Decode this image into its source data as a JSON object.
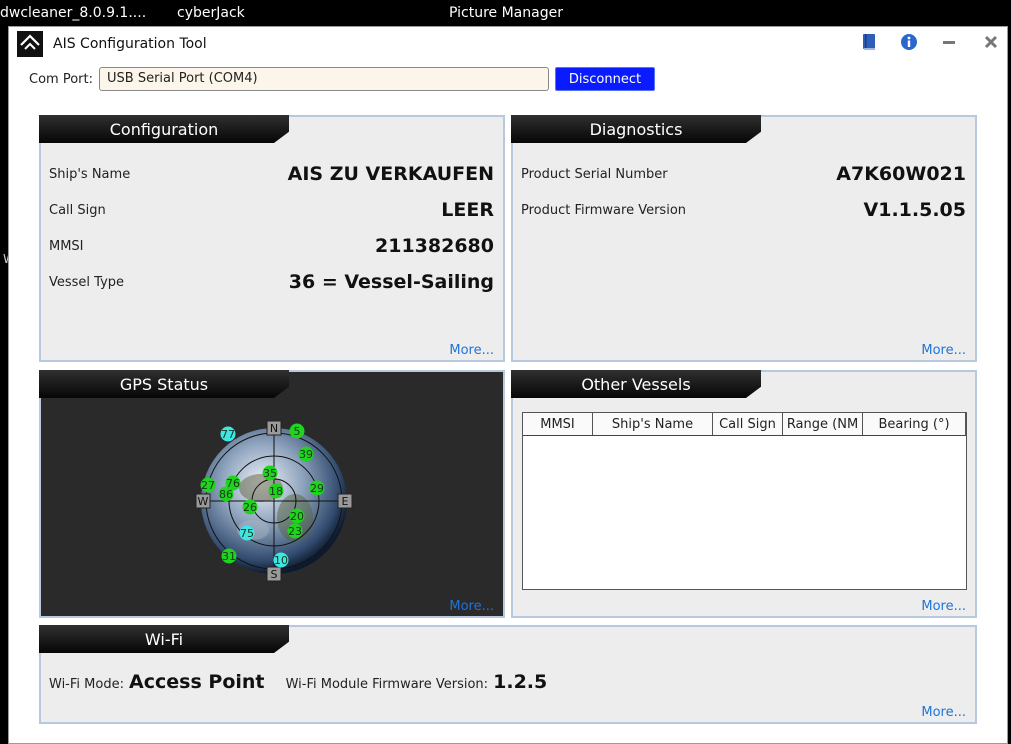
{
  "taskbar": {
    "items": [
      "dwcleaner_8.0.9.1....",
      "cyberJack",
      "Picture Manager"
    ]
  },
  "desktop_fragment": "W",
  "window": {
    "title": "AIS Configuration Tool"
  },
  "com_port": {
    "label": "Com Port:",
    "value": "USB Serial Port (COM4)",
    "button": "Disconnect"
  },
  "configuration": {
    "title": "Configuration",
    "rows": [
      {
        "label": "Ship's Name",
        "value": "AIS ZU VERKAUFEN"
      },
      {
        "label": "Call Sign",
        "value": "LEER"
      },
      {
        "label": "MMSI",
        "value": "211382680"
      },
      {
        "label": "Vessel Type",
        "value": "36 = Vessel-Sailing"
      }
    ],
    "more": "More..."
  },
  "diagnostics": {
    "title": "Diagnostics",
    "rows": [
      {
        "label": "Product Serial Number",
        "value": "A7K60W021"
      },
      {
        "label": "Product Firmware Version",
        "value": "V1.1.5.05"
      }
    ],
    "more": "More..."
  },
  "gps": {
    "title": "GPS Status",
    "compass": {
      "n": "N",
      "s": "S",
      "e": "E",
      "w": "W"
    },
    "satellites": [
      {
        "id": "77",
        "color": "#3fe6e6"
      },
      {
        "id": "5",
        "color": "#1fd31f"
      },
      {
        "id": "39",
        "color": "#1fd31f"
      },
      {
        "id": "76",
        "color": "#1fd31f"
      },
      {
        "id": "35",
        "color": "#1fd31f"
      },
      {
        "id": "27",
        "color": "#1fd31f"
      },
      {
        "id": "86",
        "color": "#1fd31f"
      },
      {
        "id": "18",
        "color": "#1fd31f"
      },
      {
        "id": "29",
        "color": "#1fd31f"
      },
      {
        "id": "26",
        "color": "#1fd31f"
      },
      {
        "id": "20",
        "color": "#1fd31f"
      },
      {
        "id": "75",
        "color": "#3fe6e6"
      },
      {
        "id": "23",
        "color": "#1fd31f"
      },
      {
        "id": "31",
        "color": "#1fd31f"
      },
      {
        "id": "10",
        "color": "#3fe6e6"
      }
    ],
    "more": "More..."
  },
  "other_vessels": {
    "title": "Other Vessels",
    "columns": [
      "MMSI",
      "Ship's Name",
      "Call Sign",
      "Range (NM",
      "Bearing (°)"
    ],
    "rows": [],
    "more": "More..."
  },
  "wifi": {
    "title": "Wi-Fi",
    "mode_label": "Wi-Fi Mode:",
    "mode_value": "Access Point",
    "fw_label": "Wi-Fi  Module Firmware Version:",
    "fw_value": "1.2.5",
    "more": "More..."
  },
  "colors": {
    "panel_border": "#b6c9de",
    "link": "#1f74d6",
    "disconnect_button": "#0a1cff",
    "panel_bg": "#ededed"
  }
}
